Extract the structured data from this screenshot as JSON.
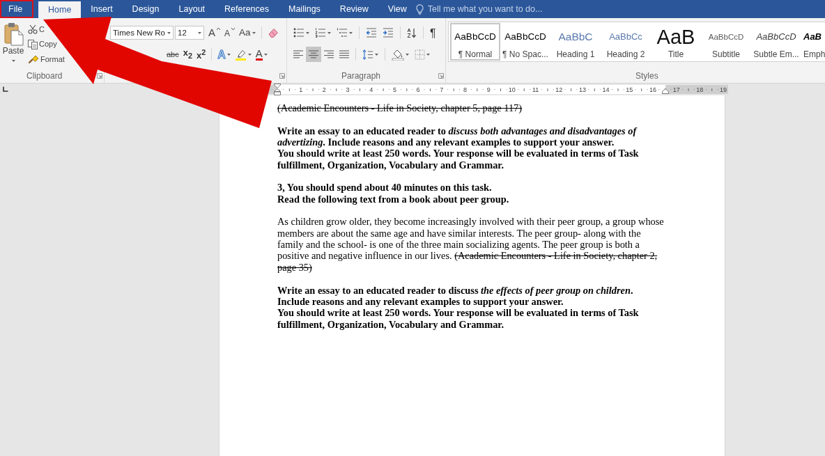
{
  "tabs": [
    {
      "label": "File",
      "selected": false,
      "highlighted": true
    },
    {
      "label": "Home",
      "selected": true,
      "highlighted": false
    },
    {
      "label": "Insert",
      "selected": false,
      "highlighted": false
    },
    {
      "label": "Design",
      "selected": false,
      "highlighted": false
    },
    {
      "label": "Layout",
      "selected": false,
      "highlighted": false
    },
    {
      "label": "References",
      "selected": false,
      "highlighted": false
    },
    {
      "label": "Mailings",
      "selected": false,
      "highlighted": false
    },
    {
      "label": "Review",
      "selected": false,
      "highlighted": false
    },
    {
      "label": "View",
      "selected": false,
      "highlighted": false
    }
  ],
  "tell_me": {
    "placeholder": "Tell me what you want to do..."
  },
  "clipboard": {
    "paste": "Paste",
    "items": [
      {
        "kind": "cut",
        "label": "C"
      },
      {
        "kind": "copy",
        "label": "Copy"
      },
      {
        "kind": "painter",
        "label": "Format"
      }
    ],
    "label": "Clipboard"
  },
  "font": {
    "name": "Times New Ro",
    "size": "12",
    "tools": [
      {
        "kind": "grow",
        "glyph": "A"
      },
      {
        "kind": "shrink",
        "glyph": "A"
      },
      {
        "kind": "case",
        "glyph": "Aa"
      },
      {
        "kind": "clear"
      }
    ],
    "format": [
      {
        "kind": "strike",
        "glyph": "abc"
      },
      {
        "kind": "sub",
        "glyph": "x$_{2}$"
      },
      {
        "kind": "sup",
        "glyph": "x$^{2}$"
      },
      {
        "kind": "effects",
        "glyph": "A"
      },
      {
        "kind": "highlight"
      },
      {
        "kind": "color",
        "glyph": "A"
      }
    ]
  },
  "paragraph": {
    "label": "Paragraph",
    "tools": [
      {
        "kind": "bullets"
      },
      {
        "kind": "numbering"
      },
      {
        "kind": "multilevel"
      },
      {
        "kind": "outdent"
      },
      {
        "kind": "indent"
      },
      {
        "kind": "sort"
      },
      {
        "kind": "marks",
        "glyph": "¶"
      }
    ],
    "align": [
      {
        "kind": "left",
        "selected": false
      },
      {
        "kind": "center",
        "selected": true
      },
      {
        "kind": "right",
        "selected": false
      },
      {
        "kind": "justify",
        "selected": false
      }
    ],
    "extras": [
      {
        "kind": "spacing"
      },
      {
        "kind": "shading"
      },
      {
        "kind": "borders"
      }
    ]
  },
  "styles": {
    "label": "Styles",
    "items": [
      {
        "kind": "normal",
        "preview": "AaBbCcD",
        "name": "¶ Normal",
        "selected": true
      },
      {
        "kind": "normal",
        "preview": "AaBbCcD",
        "name": "¶ No Spac...",
        "selected": false
      },
      {
        "kind": "heading1",
        "preview": "AaBbC",
        "name": "Heading 1",
        "selected": false
      },
      {
        "kind": "heading2",
        "preview": "AaBbCc",
        "name": "Heading 2",
        "selected": false
      },
      {
        "kind": "title",
        "preview": "AaB",
        "name": "Title",
        "selected": false
      },
      {
        "kind": "subtitle",
        "preview": "AaBbCcD",
        "name": "Subtitle",
        "selected": false
      },
      {
        "kind": "subtle",
        "preview": "AaBbCcD",
        "name": "Subtle Em...",
        "selected": false
      },
      {
        "kind": "emphasis",
        "preview": "AaB",
        "name": "Emph",
        "selected": false
      }
    ]
  },
  "ruler": {
    "numbers": [
      "1",
      "2",
      "3",
      "4",
      "5",
      "6",
      "7",
      "8",
      "9",
      "10",
      "11",
      "12",
      "13",
      "14",
      "15",
      "16",
      "17",
      "18",
      "19"
    ]
  },
  "document": {
    "blocks": [
      {
        "kind": "citation",
        "text": "(Academic Encounters - Life in Society, chapter 5, page 117)"
      },
      {
        "kind": "bold",
        "lines": [
          "Write an essay to an educated reader to *discuss both advantages and disadvantages of advertizing*. Include reasons and any relevant examples to support your answer.",
          "You should write at least 250 words. Your response will be evaluated in terms of Task fulfillment, Organization, Vocabulary and Grammar."
        ]
      },
      {
        "kind": "bold",
        "lines": [
          "3, You should spend about 40 minutes on this task.",
          "Read the following text from a book about peer group."
        ]
      },
      {
        "kind": "plain",
        "text": "As children grow older, they become increasingly involved with their peer group, a group whose members are about the same age and have similar interests. The peer group- along with the family and the school- is one of the three main socializing agents. The peer group is both a positive and negative influence in our lives.",
        "citation": "(Academic Encounters - Life in Society, chapter 2, page 35)"
      },
      {
        "kind": "bold",
        "lines": [
          "Write an essay to an educated reader to discuss *the effects of peer group on children*.",
          "Include reasons and any relevant examples to support your answer.",
          "You should write at least 250 words. Your response will be evaluated in terms of Task fulfillment, Organization, Vocabulary and Grammar."
        ]
      }
    ]
  }
}
